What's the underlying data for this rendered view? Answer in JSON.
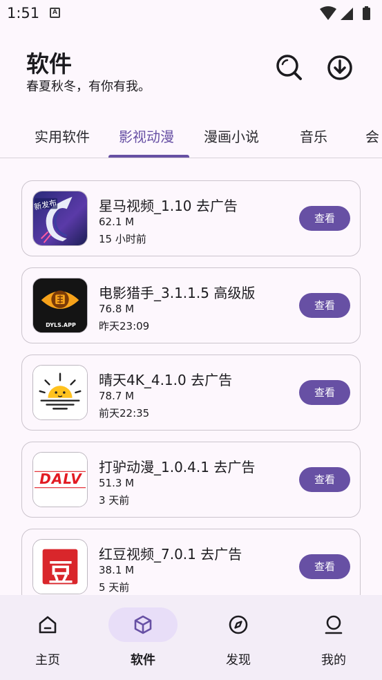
{
  "status_bar": {
    "time": "1:51"
  },
  "header": {
    "title": "软件",
    "subtitle": "春夏秋冬，有你有我。"
  },
  "tabs": [
    {
      "label": "实用软件",
      "active": false
    },
    {
      "label": "影视动漫",
      "active": true
    },
    {
      "label": "漫画小说",
      "active": false
    },
    {
      "label": "音乐",
      "active": false
    },
    {
      "label": "会",
      "active": false
    }
  ],
  "apps": [
    {
      "name": "星马视频_1.10 去广告",
      "size": "62.1 M",
      "time": "15 小时前",
      "button": "查看",
      "icon": "unicorn-icon",
      "badge": "新发布"
    },
    {
      "name": "电影猎手_3.1.1.5 高级版",
      "size": "76.8 M",
      "time": "昨天23:09",
      "button": "查看",
      "icon": "movie-hunter-icon",
      "badge": "DYLS.APP"
    },
    {
      "name": "晴天4K_4.1.0 去广告",
      "size": "78.7 M",
      "time": "前天22:35",
      "button": "查看",
      "icon": "sunrise-icon"
    },
    {
      "name": "打驴动漫_1.0.4.1 去广告",
      "size": "51.3 M",
      "time": "3 天前",
      "button": "查看",
      "icon": "dalv-icon",
      "badge": "DALV"
    },
    {
      "name": "红豆视频_7.0.1 去广告",
      "size": "38.1 M",
      "time": "5 天前",
      "button": "查看",
      "icon": "red-bean-icon",
      "badge": "豆"
    }
  ],
  "bottom_nav": [
    {
      "label": "主页",
      "icon": "home-icon",
      "active": false
    },
    {
      "label": "软件",
      "icon": "cube-icon",
      "active": true
    },
    {
      "label": "发现",
      "icon": "compass-icon",
      "active": false
    },
    {
      "label": "我的",
      "icon": "person-icon",
      "active": false
    }
  ],
  "colors": {
    "accent": "#6750a4",
    "background": "#fdf7fd",
    "nav_background": "#f3edf7",
    "active_pill": "#e8def8"
  }
}
